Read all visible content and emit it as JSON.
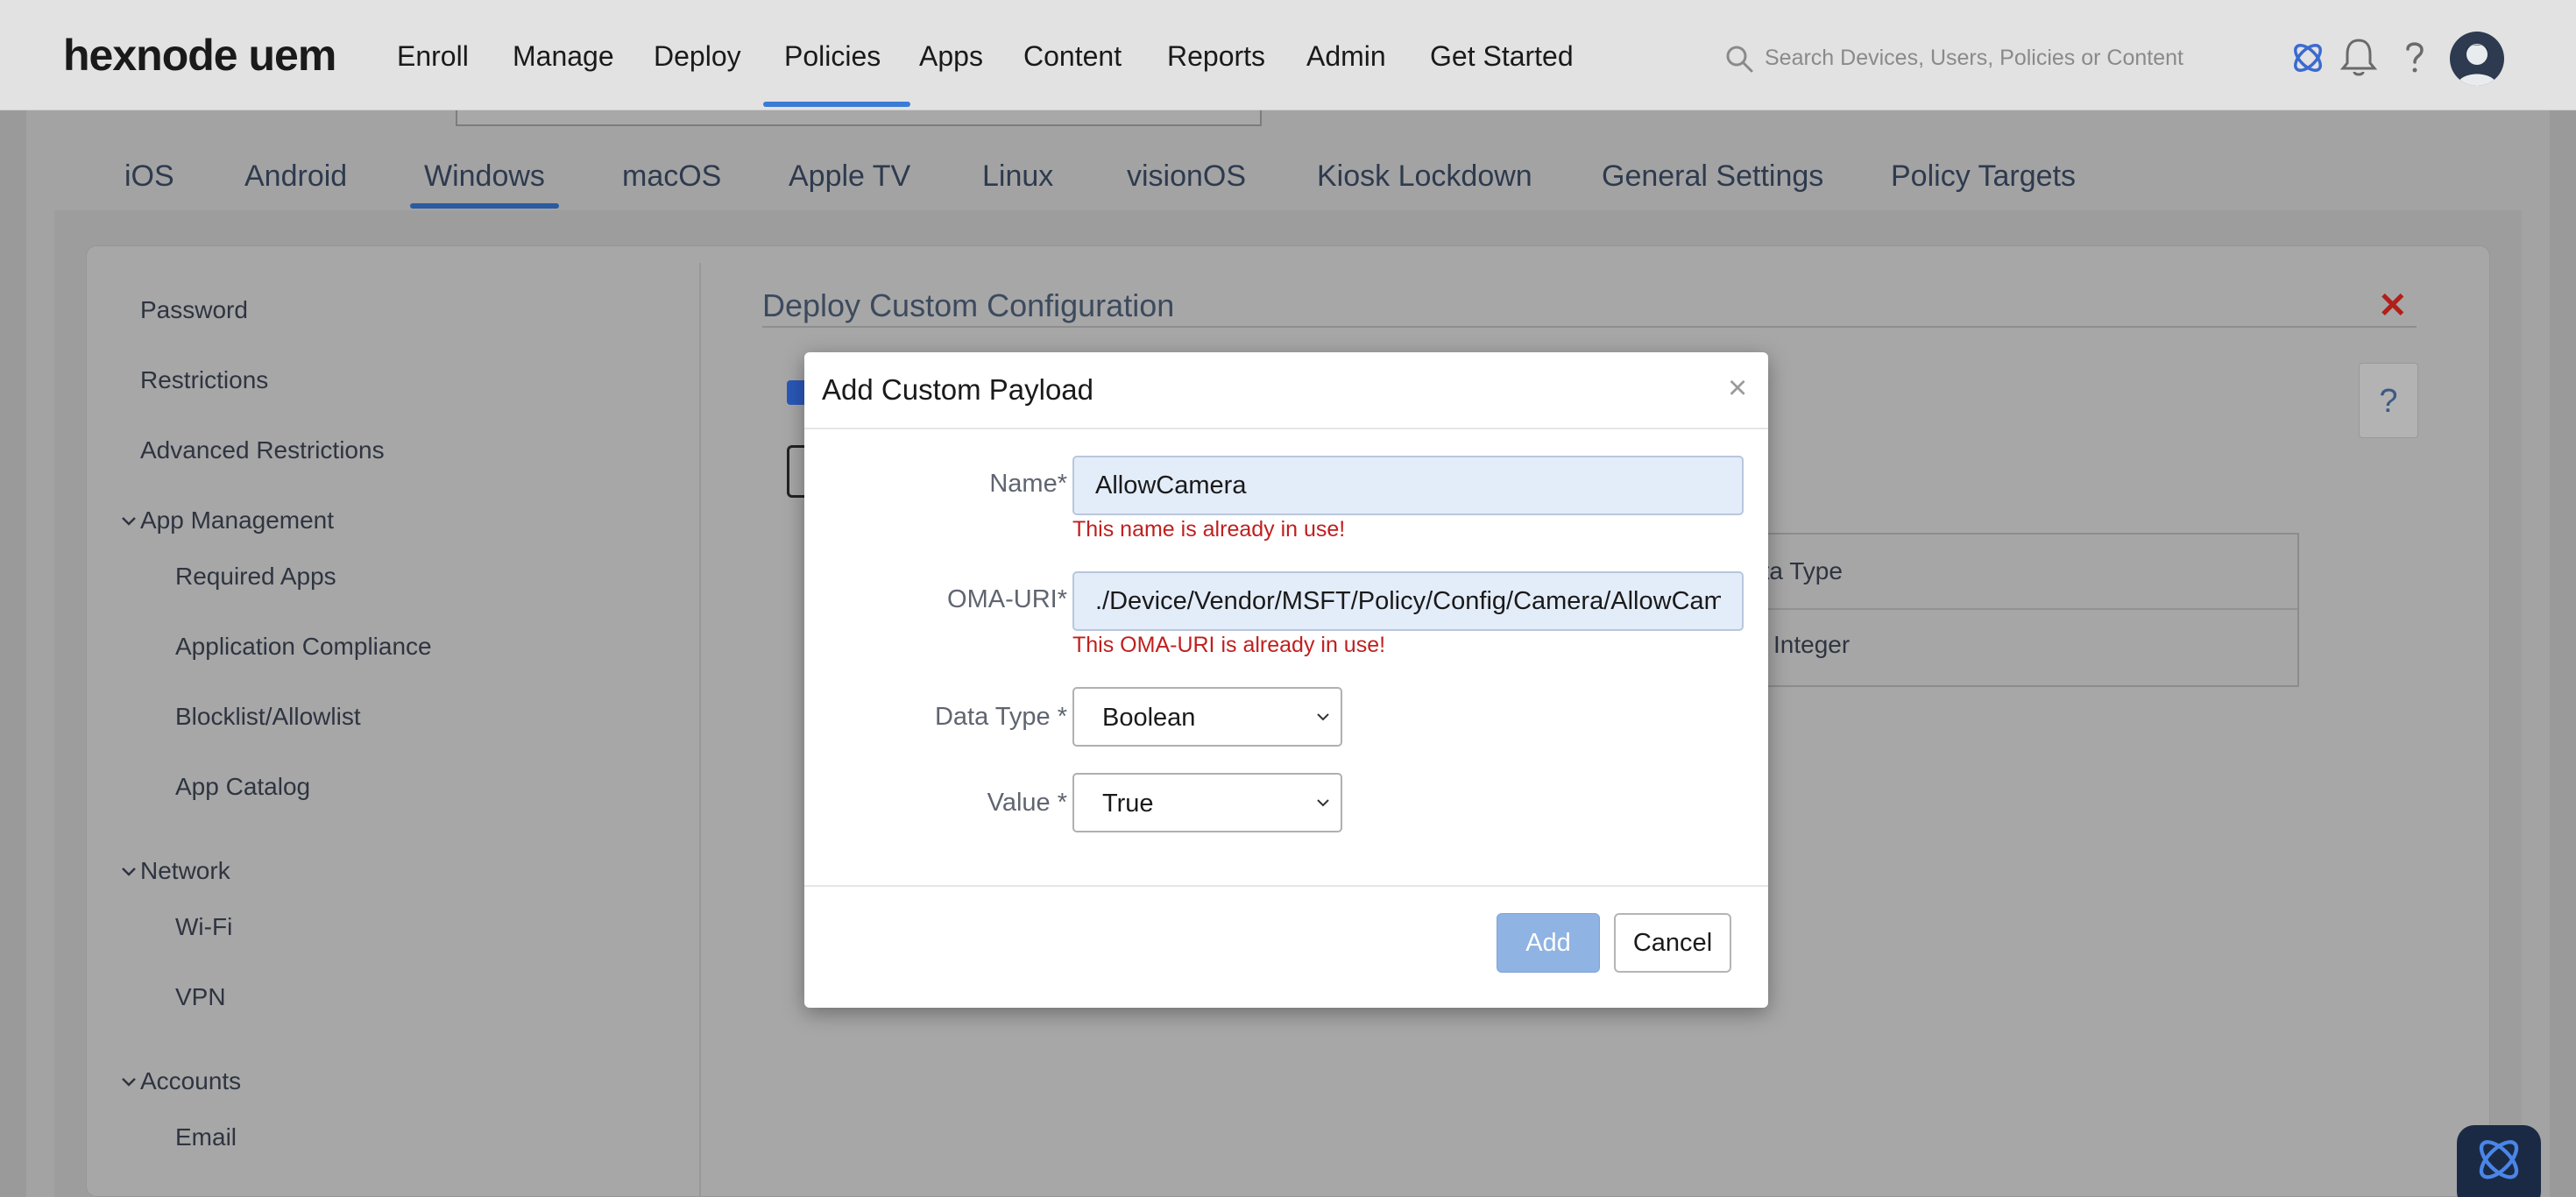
{
  "app": {
    "logo": "hexnode uem"
  },
  "topnav": {
    "items": [
      "Enroll",
      "Manage",
      "Deploy",
      "Policies",
      "Apps",
      "Content",
      "Reports",
      "Admin",
      "Get Started"
    ],
    "active": "Policies",
    "search_placeholder": "Search Devices, Users, Policies or Content"
  },
  "os_tabs": {
    "items": [
      "iOS",
      "Android",
      "Windows",
      "macOS",
      "Apple TV",
      "Linux",
      "visionOS",
      "Kiosk Lockdown",
      "General Settings",
      "Policy Targets"
    ],
    "active": "Windows"
  },
  "sidebar": {
    "password": "Password",
    "restrictions": "Restrictions",
    "advanced_restrictions": "Advanced Restrictions",
    "app_management": "App Management",
    "required_apps": "Required Apps",
    "application_compliance": "Application Compliance",
    "blocklist_allowlist": "Blocklist/Allowlist",
    "app_catalog": "App Catalog",
    "network": "Network",
    "wifi": "Wi-Fi",
    "vpn": "VPN",
    "accounts": "Accounts",
    "email": "Email"
  },
  "content": {
    "title": "Deploy Custom Configuration",
    "help": "?",
    "table_header_partial": "ata Type",
    "table_cell_partial": "Integer"
  },
  "modal": {
    "title": "Add Custom Payload",
    "name_label": "Name*",
    "name_value": "AllowCamera",
    "name_error": "This name is already in use!",
    "oma_label": "OMA-URI*",
    "oma_value": "./Device/Vendor/MSFT/Policy/Config/Camera/AllowCame",
    "oma_error": "This OMA-URI is already in use!",
    "datatype_label": "Data Type *",
    "datatype_value": "Boolean",
    "value_label": "Value *",
    "value_value": "True",
    "add_label": "Add",
    "cancel_label": "Cancel"
  },
  "colors": {
    "accent": "#3a7bd5",
    "error": "#c01f1f",
    "add_button": "#8fb3e3",
    "close_red": "#b0201a"
  },
  "icons": [
    "search-icon",
    "hexnode-logo-icon",
    "bell-icon",
    "help-icon",
    "avatar",
    "close-icon",
    "chevron-down-icon",
    "chat-widget-icon"
  ]
}
